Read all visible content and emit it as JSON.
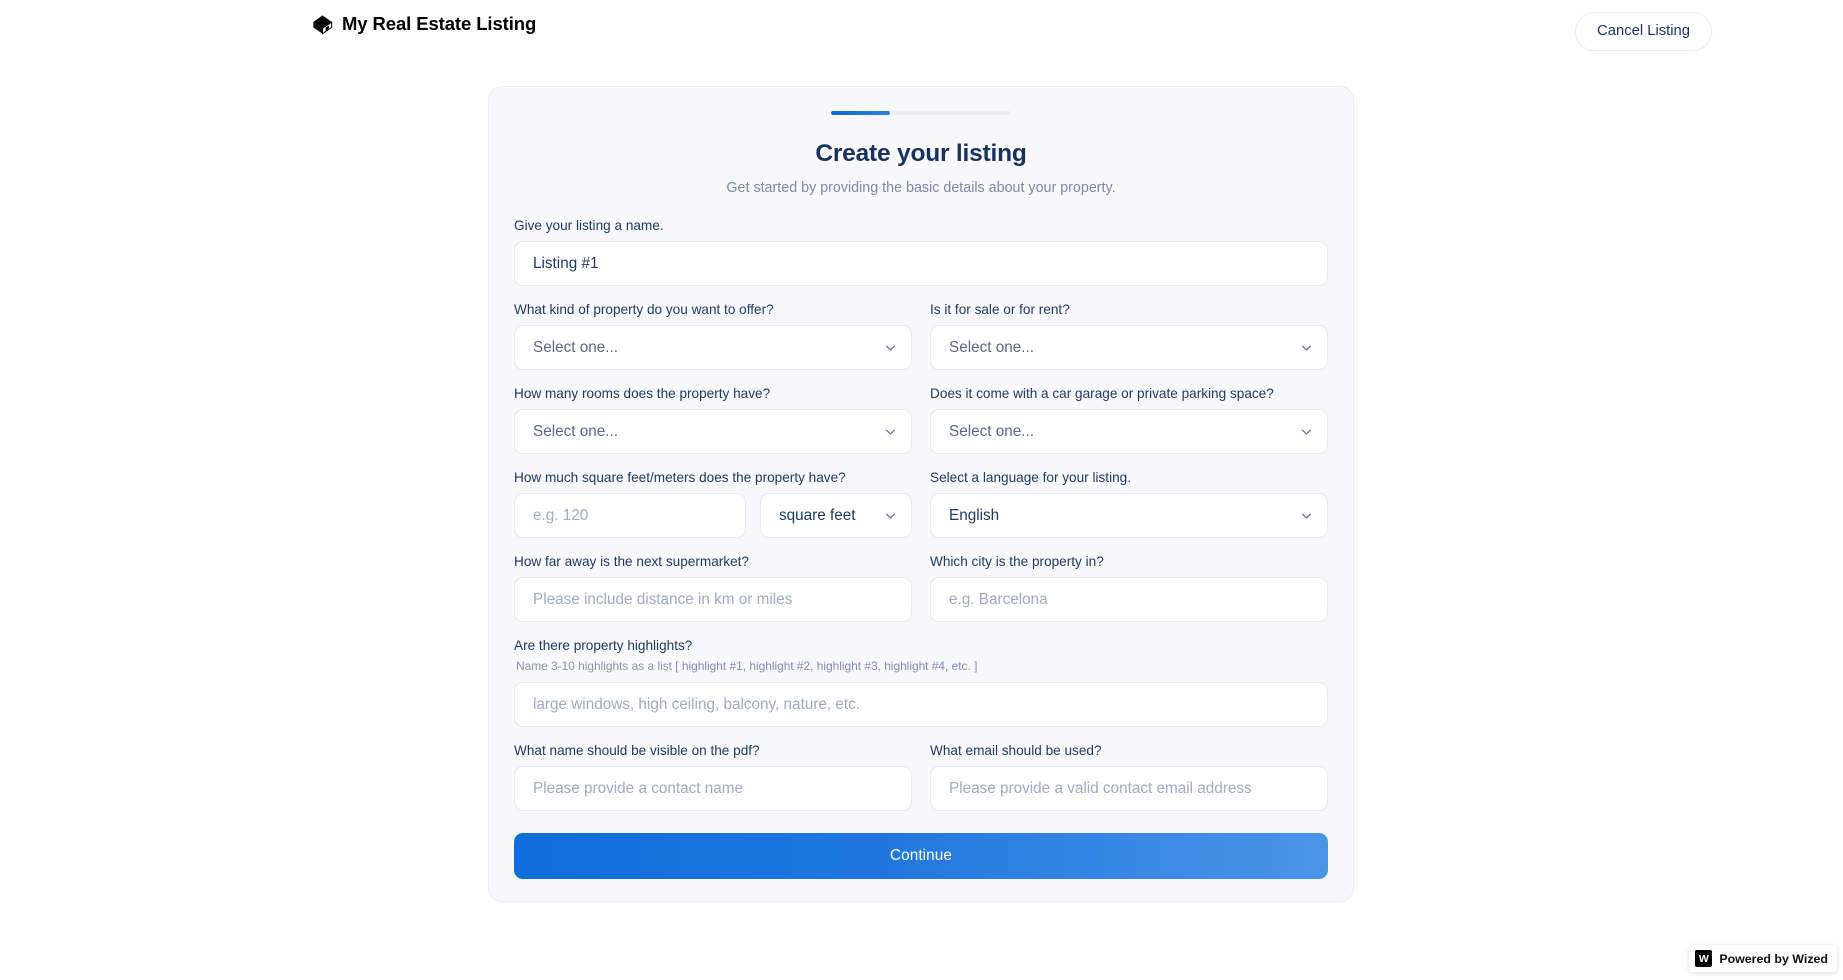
{
  "header": {
    "brand_name": "My Real Estate Listing",
    "logo_icon": "cube-diamond-icon",
    "cancel_label": "Cancel Listing"
  },
  "card": {
    "progress_percent": 33,
    "title": "Create your listing",
    "subtitle": "Get started by providing the basic details about your property.",
    "accent_color": "#1268d4"
  },
  "form": {
    "listing_name": {
      "label": "Give your listing a name.",
      "value": "Listing #1",
      "placeholder": "Listing #1"
    },
    "property_kind": {
      "label": "What kind of property do you want to offer?",
      "value": "Select one...",
      "icon": "chevron-down-icon"
    },
    "sale_or_rent": {
      "label": "Is it for sale or for rent?",
      "value": "Select one...",
      "icon": "chevron-down-icon"
    },
    "rooms": {
      "label": "How many rooms does the property have?",
      "value": "Select one...",
      "icon": "chevron-down-icon"
    },
    "garage": {
      "label": "Does it come with a car garage or private parking space?",
      "value": "Select one...",
      "icon": "chevron-down-icon"
    },
    "area": {
      "label": "How much square feet/meters does the property have?",
      "placeholder": "e.g. 120",
      "value": "",
      "unit_value": "square feet",
      "unit_icon": "chevron-down-icon"
    },
    "language": {
      "label": "Select a language for your listing.",
      "value": "English",
      "icon": "chevron-down-icon"
    },
    "supermarket": {
      "label": "How far away is the next supermarket?",
      "placeholder": "Please include distance in km or miles",
      "value": ""
    },
    "city": {
      "label": "Which city is the property in?",
      "placeholder": "e.g. Barcelona",
      "value": ""
    },
    "highlights": {
      "label": "Are there property highlights?",
      "hint_prefix": "Name 3-10 highlights as a list",
      "hint_bracket": "[ highlight #1, highlight #2, highlight #3, highlight #4, etc. ]",
      "placeholder": "large windows, high ceiling, balcony, nature, etc.",
      "value": ""
    },
    "contact_name": {
      "label": "What name should be visible on the pdf?",
      "placeholder": "Please provide a contact name",
      "value": ""
    },
    "contact_email": {
      "label": "What email should be used?",
      "placeholder": "Please provide a valid contact email address",
      "value": ""
    },
    "continue_label": "Continue"
  },
  "badge": {
    "mark": "W",
    "text": "Powered by Wized"
  }
}
